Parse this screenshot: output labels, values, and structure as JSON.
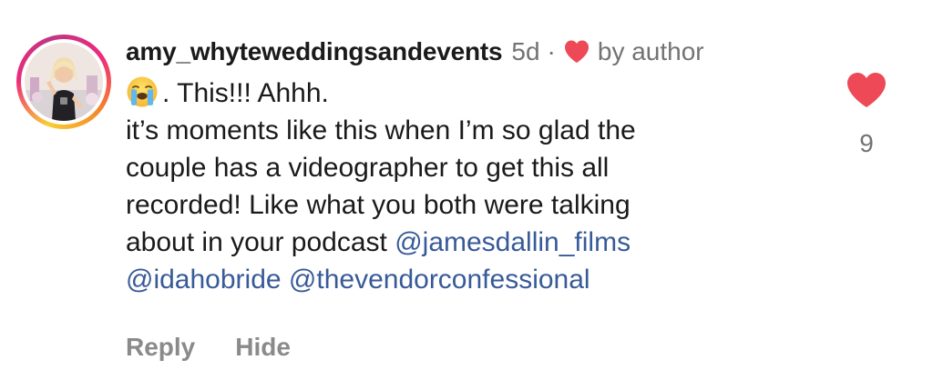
{
  "comment": {
    "username": "amy_whyteweddingsandevents",
    "time": "5d",
    "separator": "·",
    "liked_by_author_label": "by author",
    "first_line_text": ". This!!! Ahhh.",
    "first_line_emoji": "loudly-crying-face-emoji",
    "body_lines": [
      "it’s moments like this when I’m so glad the",
      "couple has a videographer to get this all",
      "recorded!  Like what you both were talking",
      "about in your podcast "
    ],
    "mentions": [
      "@jamesdallin_films",
      "@idahobride",
      "@thevendorconfessional"
    ],
    "like_count": "9",
    "actions": {
      "reply": "Reply",
      "hide": "Hide"
    }
  },
  "icons": {
    "author_heart": "heart-icon",
    "like_button": "heart-filled-icon"
  },
  "colors": {
    "heart": "#ed4956",
    "mention": "#385a98",
    "muted": "#737373",
    "action": "#8a8a8a"
  }
}
